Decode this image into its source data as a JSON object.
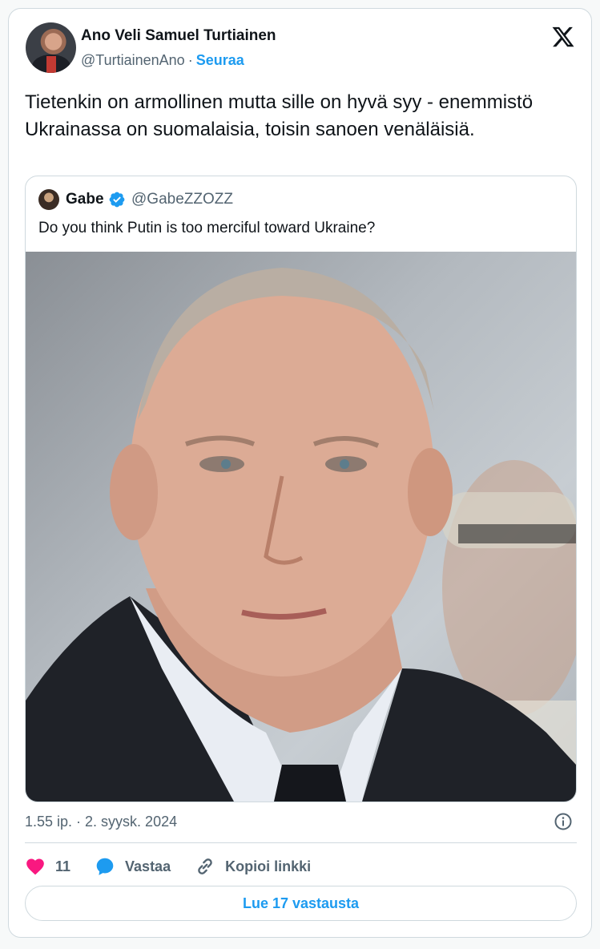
{
  "author": {
    "name": "Ano Veli Samuel Turtiainen",
    "handle": "@TurtiainenAno",
    "separator": "·",
    "follow_label": "Seuraa"
  },
  "tweet": {
    "text": "Tietenkin on armollinen mutta sille on hyvä syy - enemmistö Ukrainassa on suomalaisia, toisin sanoen venäläisiä.",
    "timestamp": "1.55 ip. · 2. syysk. 2024"
  },
  "quoted": {
    "name": "Gabe",
    "handle": "@GabeZZOZZ",
    "verified": true,
    "text": "Do you think Putin is too merciful toward Ukraine?"
  },
  "actions": {
    "likes_count": "11",
    "reply_label": "Vastaa",
    "copy_link_label": "Kopioi linkki",
    "read_replies_label": "Lue 17 vastausta"
  },
  "colors": {
    "accent": "#1d9bf0",
    "like": "#f91880",
    "text_secondary": "#536471",
    "border": "#cfd9de"
  },
  "icons": [
    "x-logo-icon",
    "verified-badge-icon",
    "info-icon",
    "heart-icon",
    "reply-icon",
    "link-icon"
  ]
}
